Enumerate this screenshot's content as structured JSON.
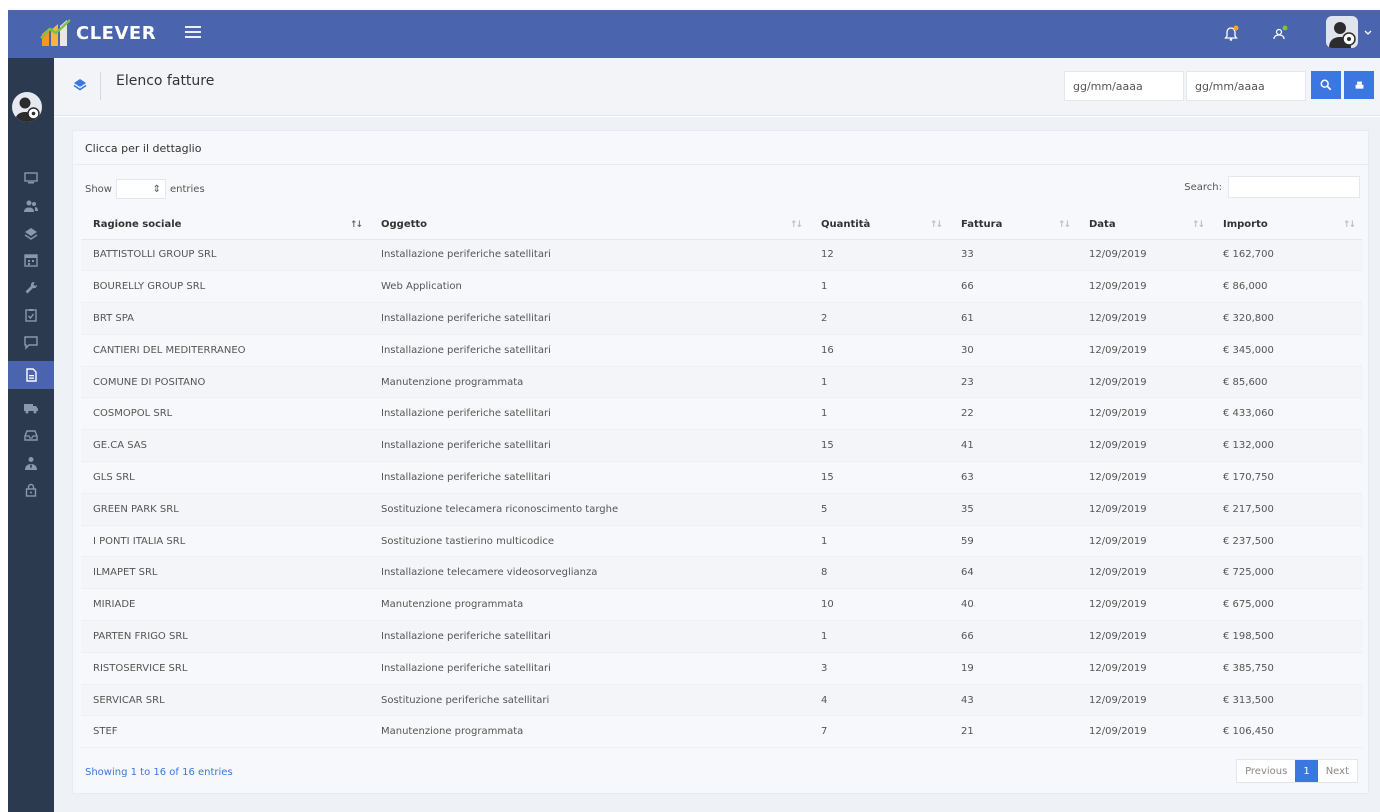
{
  "app": {
    "brand": "CLEVER"
  },
  "header": {
    "title": "Elenco fatture",
    "date_from_placeholder": "gg/mm/aaaa",
    "date_to_placeholder": "gg/mm/aaaa"
  },
  "panel": {
    "title": "Clicca per il dettaglio",
    "show_label": "Show",
    "entries_label": "entries",
    "search_label": "Search:"
  },
  "table": {
    "columns": [
      "Ragione sociale",
      "Oggetto",
      "Quantità",
      "Fattura",
      "Data",
      "Importo"
    ],
    "rows": [
      [
        "BATTISTOLLI GROUP SRL",
        "Installazione periferiche satellitari",
        "12",
        "33",
        "12/09/2019",
        "€ 162,700"
      ],
      [
        "BOURELLY GROUP SRL",
        "Web Application",
        "1",
        "66",
        "12/09/2019",
        "€ 86,000"
      ],
      [
        "BRT SPA",
        "Installazione periferiche satellitari",
        "2",
        "61",
        "12/09/2019",
        "€ 320,800"
      ],
      [
        "CANTIERI DEL MEDITERRANEO",
        "Installazione periferiche satellitari",
        "16",
        "30",
        "12/09/2019",
        "€ 345,000"
      ],
      [
        "COMUNE DI POSITANO",
        "Manutenzione programmata",
        "1",
        "23",
        "12/09/2019",
        "€ 85,600"
      ],
      [
        "COSMOPOL SRL",
        "Installazione periferiche satellitari",
        "1",
        "22",
        "12/09/2019",
        "€ 433,060"
      ],
      [
        "GE.CA SAS",
        "Installazione periferiche satellitari",
        "15",
        "41",
        "12/09/2019",
        "€ 132,000"
      ],
      [
        "GLS SRL",
        "Installazione periferiche satellitari",
        "15",
        "63",
        "12/09/2019",
        "€ 170,750"
      ],
      [
        "GREEN PARK SRL",
        "Sostituzione telecamera riconoscimento targhe",
        "5",
        "35",
        "12/09/2019",
        "€ 217,500"
      ],
      [
        "I PONTI ITALIA SRL",
        "Sostituzione tastierino multicodice",
        "1",
        "59",
        "12/09/2019",
        "€ 237,500"
      ],
      [
        "ILMAPET SRL",
        "Installazione telecamere videosorveglianza",
        "8",
        "64",
        "12/09/2019",
        "€ 725,000"
      ],
      [
        "MIRIADE",
        "Manutenzione programmata",
        "10",
        "40",
        "12/09/2019",
        "€ 675,000"
      ],
      [
        "PARTEN FRIGO SRL",
        "Installazione periferiche satellitari",
        "1",
        "66",
        "12/09/2019",
        "€ 198,500"
      ],
      [
        "RISTOSERVICE SRL",
        "Installazione periferiche satellitari",
        "3",
        "19",
        "12/09/2019",
        "€ 385,750"
      ],
      [
        "SERVICAR SRL",
        "Sostituzione periferiche satellitari",
        "4",
        "43",
        "12/09/2019",
        "€ 313,500"
      ],
      [
        "STEF",
        "Manutenzione programmata",
        "7",
        "21",
        "12/09/2019",
        "€ 106,450"
      ]
    ]
  },
  "footer": {
    "showing": "Showing 1 to 16 of 16 entries",
    "prev": "Previous",
    "page": "1",
    "next": "Next"
  },
  "icons": {
    "sidebar": [
      "monitor-icon",
      "users-icon",
      "layers-icon",
      "calendar-icon",
      "wrench-icon",
      "clipboard-icon",
      "chat-icon",
      "invoice-icon",
      "truck-icon",
      "inbox-icon",
      "user-tie-icon",
      "lock-icon"
    ],
    "top": [
      "bell-icon",
      "user-icon",
      "avatar",
      "chevron-down-icon"
    ]
  },
  "colors": {
    "primary": "#4a64ad",
    "sidebar": "#2c3a4f",
    "accent": "#3b76e1"
  }
}
